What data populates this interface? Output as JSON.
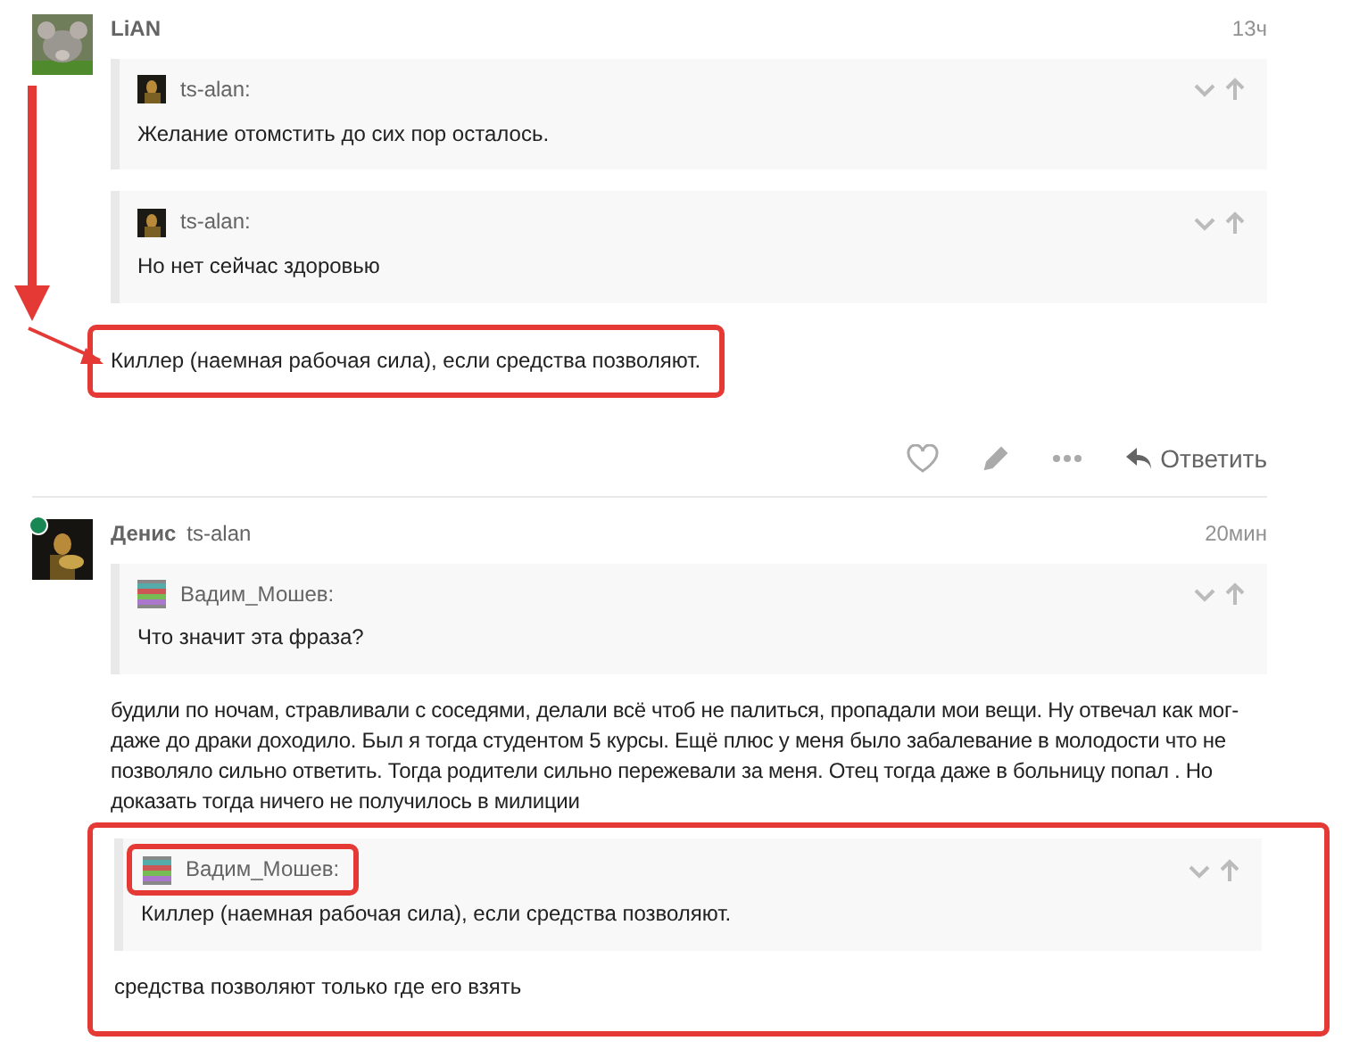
{
  "posts": [
    {
      "author": "LiAN",
      "time": "13ч",
      "online": false,
      "blocks": [
        {
          "kind": "quote",
          "author": "ts-alan:",
          "text": "Желание отомстить до сих пор осталось.",
          "author_highlighted": false
        },
        {
          "kind": "quote",
          "author": "ts-alan:",
          "text": "Но нет сейчас здоровью",
          "author_highlighted": false
        },
        {
          "kind": "text",
          "text": "Киллер (наемная рабочая сила), если средства позволяют.",
          "highlighted": true,
          "arrow": true
        }
      ],
      "actions": {
        "reply_label": "Ответить"
      }
    },
    {
      "author": "Денис",
      "tag": "ts-alan",
      "time": "20мин",
      "online": true,
      "blocks": [
        {
          "kind": "quote",
          "author": "Вадим_Мошев:",
          "text": "Что значит эта фраза?",
          "author_highlighted": false
        },
        {
          "kind": "text",
          "text": "будили по ночам, стравливали с соседями, делали всё чтоб не палиться, пропадали мои вещи. Ну отвечал как мог- даже до драки доходило. Был я тогда студентом 5 курсы. Ещё плюс у меня было забалевание в молодости что не позволяло сильно ответить. Тогда родители сильно пережевали за меня. Отец тогда даже в больницу попал . Но доказать тогда ничего не получилось в милиции",
          "highlighted": false,
          "arrow": false
        },
        {
          "kind": "group",
          "highlighted": true,
          "children": [
            {
              "kind": "quote",
              "author": "Вадим_Мошев:",
              "text": "Киллер (наемная рабочая сила), если средства позволяют.",
              "author_highlighted": true
            },
            {
              "kind": "text",
              "text": "средства позволяют только где его взять",
              "highlighted": false,
              "arrow": false
            }
          ]
        }
      ]
    }
  ]
}
